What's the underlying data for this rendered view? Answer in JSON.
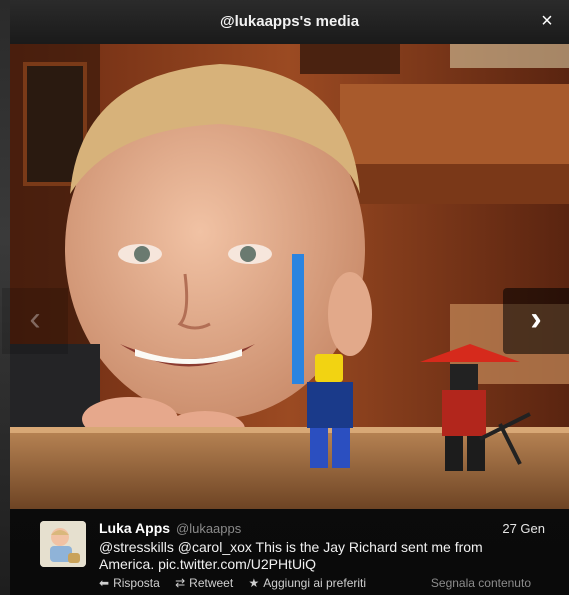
{
  "modal": {
    "title": "@lukaapps's media",
    "close_icon": "×",
    "prev_icon": "‹",
    "next_icon": "›"
  },
  "tweet": {
    "name": "Luka Apps",
    "handle": "@lukaapps",
    "date": "27 Gen",
    "text": "@stresskills @carol_xox This is the Jay Richard sent me from America. pic.twitter.com/U2PHtUiQ",
    "actions": [
      {
        "icon": "reply-icon",
        "glyph": "⬅",
        "label": "Risposta"
      },
      {
        "icon": "retweet-icon",
        "glyph": "⇄",
        "label": "Retweet"
      },
      {
        "icon": "star-icon",
        "glyph": "★",
        "label": "Aggiungi ai preferiti"
      }
    ],
    "report_label": "Segnala contenuto"
  }
}
